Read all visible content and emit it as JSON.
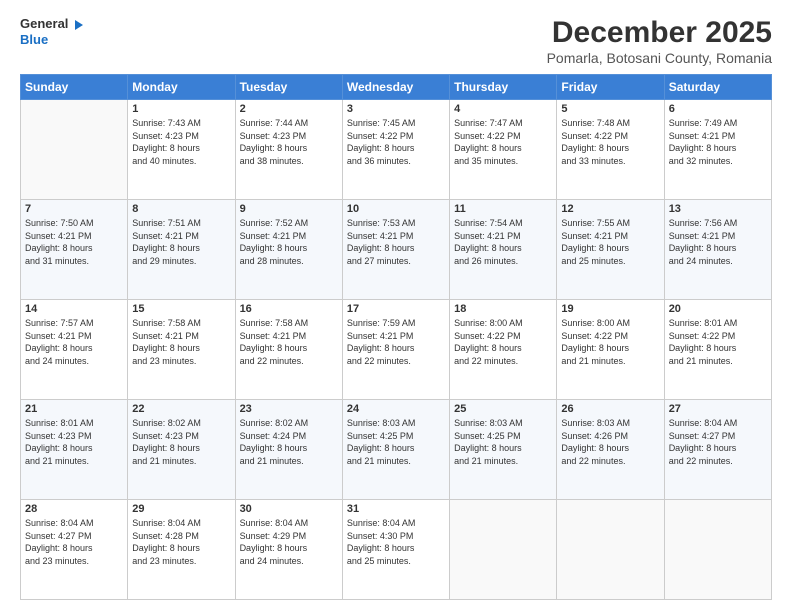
{
  "logo": {
    "line1": "General",
    "line2": "Blue"
  },
  "title": "December 2025",
  "subtitle": "Pomarla, Botosani County, Romania",
  "weekdays": [
    "Sunday",
    "Monday",
    "Tuesday",
    "Wednesday",
    "Thursday",
    "Friday",
    "Saturday"
  ],
  "weeks": [
    [
      {
        "day": "",
        "info": ""
      },
      {
        "day": "1",
        "info": "Sunrise: 7:43 AM\nSunset: 4:23 PM\nDaylight: 8 hours\nand 40 minutes."
      },
      {
        "day": "2",
        "info": "Sunrise: 7:44 AM\nSunset: 4:23 PM\nDaylight: 8 hours\nand 38 minutes."
      },
      {
        "day": "3",
        "info": "Sunrise: 7:45 AM\nSunset: 4:22 PM\nDaylight: 8 hours\nand 36 minutes."
      },
      {
        "day": "4",
        "info": "Sunrise: 7:47 AM\nSunset: 4:22 PM\nDaylight: 8 hours\nand 35 minutes."
      },
      {
        "day": "5",
        "info": "Sunrise: 7:48 AM\nSunset: 4:22 PM\nDaylight: 8 hours\nand 33 minutes."
      },
      {
        "day": "6",
        "info": "Sunrise: 7:49 AM\nSunset: 4:21 PM\nDaylight: 8 hours\nand 32 minutes."
      }
    ],
    [
      {
        "day": "7",
        "info": "Sunrise: 7:50 AM\nSunset: 4:21 PM\nDaylight: 8 hours\nand 31 minutes."
      },
      {
        "day": "8",
        "info": "Sunrise: 7:51 AM\nSunset: 4:21 PM\nDaylight: 8 hours\nand 29 minutes."
      },
      {
        "day": "9",
        "info": "Sunrise: 7:52 AM\nSunset: 4:21 PM\nDaylight: 8 hours\nand 28 minutes."
      },
      {
        "day": "10",
        "info": "Sunrise: 7:53 AM\nSunset: 4:21 PM\nDaylight: 8 hours\nand 27 minutes."
      },
      {
        "day": "11",
        "info": "Sunrise: 7:54 AM\nSunset: 4:21 PM\nDaylight: 8 hours\nand 26 minutes."
      },
      {
        "day": "12",
        "info": "Sunrise: 7:55 AM\nSunset: 4:21 PM\nDaylight: 8 hours\nand 25 minutes."
      },
      {
        "day": "13",
        "info": "Sunrise: 7:56 AM\nSunset: 4:21 PM\nDaylight: 8 hours\nand 24 minutes."
      }
    ],
    [
      {
        "day": "14",
        "info": "Sunrise: 7:57 AM\nSunset: 4:21 PM\nDaylight: 8 hours\nand 24 minutes."
      },
      {
        "day": "15",
        "info": "Sunrise: 7:58 AM\nSunset: 4:21 PM\nDaylight: 8 hours\nand 23 minutes."
      },
      {
        "day": "16",
        "info": "Sunrise: 7:58 AM\nSunset: 4:21 PM\nDaylight: 8 hours\nand 22 minutes."
      },
      {
        "day": "17",
        "info": "Sunrise: 7:59 AM\nSunset: 4:21 PM\nDaylight: 8 hours\nand 22 minutes."
      },
      {
        "day": "18",
        "info": "Sunrise: 8:00 AM\nSunset: 4:22 PM\nDaylight: 8 hours\nand 22 minutes."
      },
      {
        "day": "19",
        "info": "Sunrise: 8:00 AM\nSunset: 4:22 PM\nDaylight: 8 hours\nand 21 minutes."
      },
      {
        "day": "20",
        "info": "Sunrise: 8:01 AM\nSunset: 4:22 PM\nDaylight: 8 hours\nand 21 minutes."
      }
    ],
    [
      {
        "day": "21",
        "info": "Sunrise: 8:01 AM\nSunset: 4:23 PM\nDaylight: 8 hours\nand 21 minutes."
      },
      {
        "day": "22",
        "info": "Sunrise: 8:02 AM\nSunset: 4:23 PM\nDaylight: 8 hours\nand 21 minutes."
      },
      {
        "day": "23",
        "info": "Sunrise: 8:02 AM\nSunset: 4:24 PM\nDaylight: 8 hours\nand 21 minutes."
      },
      {
        "day": "24",
        "info": "Sunrise: 8:03 AM\nSunset: 4:25 PM\nDaylight: 8 hours\nand 21 minutes."
      },
      {
        "day": "25",
        "info": "Sunrise: 8:03 AM\nSunset: 4:25 PM\nDaylight: 8 hours\nand 21 minutes."
      },
      {
        "day": "26",
        "info": "Sunrise: 8:03 AM\nSunset: 4:26 PM\nDaylight: 8 hours\nand 22 minutes."
      },
      {
        "day": "27",
        "info": "Sunrise: 8:04 AM\nSunset: 4:27 PM\nDaylight: 8 hours\nand 22 minutes."
      }
    ],
    [
      {
        "day": "28",
        "info": "Sunrise: 8:04 AM\nSunset: 4:27 PM\nDaylight: 8 hours\nand 23 minutes."
      },
      {
        "day": "29",
        "info": "Sunrise: 8:04 AM\nSunset: 4:28 PM\nDaylight: 8 hours\nand 23 minutes."
      },
      {
        "day": "30",
        "info": "Sunrise: 8:04 AM\nSunset: 4:29 PM\nDaylight: 8 hours\nand 24 minutes."
      },
      {
        "day": "31",
        "info": "Sunrise: 8:04 AM\nSunset: 4:30 PM\nDaylight: 8 hours\nand 25 minutes."
      },
      {
        "day": "",
        "info": ""
      },
      {
        "day": "",
        "info": ""
      },
      {
        "day": "",
        "info": ""
      }
    ]
  ]
}
